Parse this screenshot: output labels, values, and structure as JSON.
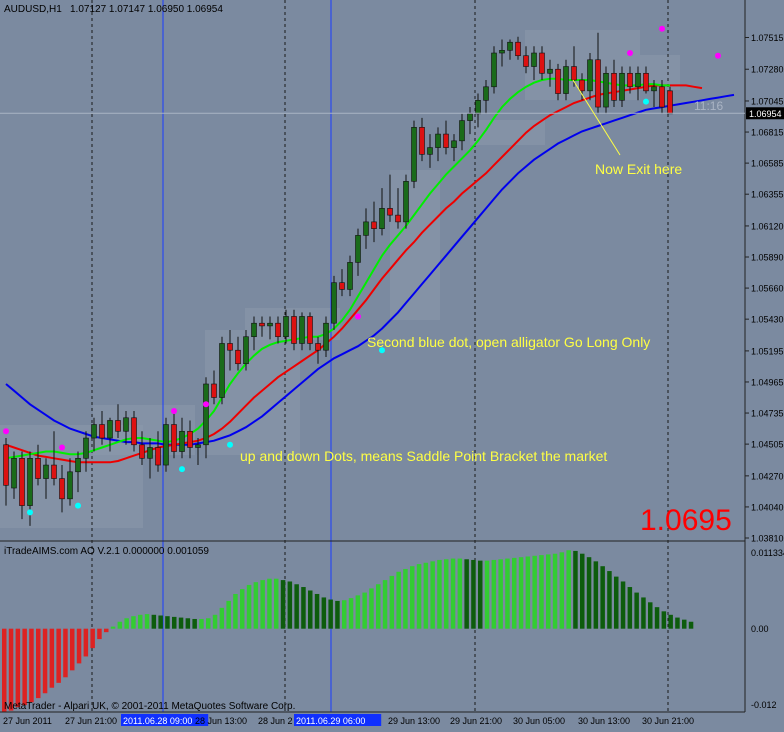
{
  "header": {
    "symbol": "AUDUSD,H1",
    "ohlc": "1.07127 1.07147 1.06950 1.06954"
  },
  "colors": {
    "background": "#7b8aa0",
    "bull_candle": "#1a6b1a",
    "bear_candle": "#dd1111",
    "green_line": "#00ee00",
    "red_line": "#ee0000",
    "blue_line": "#0000ee",
    "magenta_dot": "#ff00ff",
    "cyan_dot": "#00ffff",
    "annotation_text": "#ffff44",
    "big_price": "#ff0000"
  },
  "price_axis": {
    "ticks": [
      "1.07515",
      "1.07280",
      "1.07045",
      "1.06815",
      "1.06585",
      "1.06355",
      "1.06120",
      "1.05890",
      "1.05660",
      "1.05430",
      "1.05195",
      "1.04965",
      "1.04735",
      "1.04505",
      "1.04270",
      "1.04040",
      "1.03810"
    ],
    "current_price_label": "1.06954"
  },
  "time_label": "11:16",
  "big_price": "1.0695",
  "annotations": {
    "exit": "Now Exit here",
    "long": "Second blue dot, open alligator Go Long Only",
    "saddle": "up and down Dots, means Saddle Point Bracket the market"
  },
  "indicator": {
    "title": "iTradeAIMS.com AO V.2.1 0.000000 0.001059",
    "axis_ticks": [
      "0.011334",
      "0.00",
      "-0.012"
    ]
  },
  "copyright": "MetaTrader - Alpari UK, © 2001-2011 MetaQuotes Software Corp.",
  "time_axis": {
    "labels": [
      "27 Jun 2011",
      "27 Jun 21:00",
      "2011.06.28 09:00",
      "28 Jun 13:00",
      "28 Jun 2",
      "2011.06.29 06:00",
      "29 Jun 13:00",
      "29 Jun 21:00",
      "30 Jun 05:00",
      "30 Jun 13:00",
      "30 Jun 21:00"
    ],
    "highlighted": [
      "2011.06.28 09:00",
      "2011.06.29 06:00"
    ]
  },
  "chart_data": {
    "type": "candlestick",
    "symbol": "AUDUSD,H1",
    "ylim": [
      1.0381,
      1.076
    ],
    "candles": [
      {
        "o": 1.045,
        "h": 1.0455,
        "l": 1.0405,
        "c": 1.042
      },
      {
        "o": 1.0418,
        "h": 1.0445,
        "l": 1.041,
        "c": 1.044
      },
      {
        "o": 1.044,
        "h": 1.0445,
        "l": 1.0395,
        "c": 1.0405
      },
      {
        "o": 1.0405,
        "h": 1.0445,
        "l": 1.039,
        "c": 1.044
      },
      {
        "o": 1.044,
        "h": 1.045,
        "l": 1.042,
        "c": 1.0425
      },
      {
        "o": 1.0425,
        "h": 1.044,
        "l": 1.041,
        "c": 1.0435
      },
      {
        "o": 1.0435,
        "h": 1.046,
        "l": 1.042,
        "c": 1.0425
      },
      {
        "o": 1.0425,
        "h": 1.0435,
        "l": 1.04,
        "c": 1.041
      },
      {
        "o": 1.041,
        "h": 1.044,
        "l": 1.0405,
        "c": 1.043
      },
      {
        "o": 1.043,
        "h": 1.0445,
        "l": 1.0415,
        "c": 1.044
      },
      {
        "o": 1.044,
        "h": 1.046,
        "l": 1.043,
        "c": 1.0455
      },
      {
        "o": 1.0455,
        "h": 1.047,
        "l": 1.0445,
        "c": 1.0465
      },
      {
        "o": 1.0465,
        "h": 1.0475,
        "l": 1.045,
        "c": 1.0455
      },
      {
        "o": 1.0455,
        "h": 1.047,
        "l": 1.0445,
        "c": 1.0468
      },
      {
        "o": 1.0468,
        "h": 1.048,
        "l": 1.0455,
        "c": 1.046
      },
      {
        "o": 1.046,
        "h": 1.0475,
        "l": 1.045,
        "c": 1.047
      },
      {
        "o": 1.047,
        "h": 1.0475,
        "l": 1.0445,
        "c": 1.045
      },
      {
        "o": 1.045,
        "h": 1.046,
        "l": 1.0435,
        "c": 1.044
      },
      {
        "o": 1.044,
        "h": 1.0455,
        "l": 1.0425,
        "c": 1.0448
      },
      {
        "o": 1.0448,
        "h": 1.046,
        "l": 1.043,
        "c": 1.0435
      },
      {
        "o": 1.0435,
        "h": 1.047,
        "l": 1.043,
        "c": 1.0465
      },
      {
        "o": 1.0465,
        "h": 1.0475,
        "l": 1.044,
        "c": 1.0445
      },
      {
        "o": 1.0445,
        "h": 1.047,
        "l": 1.044,
        "c": 1.046
      },
      {
        "o": 1.046,
        "h": 1.0468,
        "l": 1.044,
        "c": 1.0448
      },
      {
        "o": 1.0448,
        "h": 1.0455,
        "l": 1.0435,
        "c": 1.045
      },
      {
        "o": 1.045,
        "h": 1.05,
        "l": 1.044,
        "c": 1.0495
      },
      {
        "o": 1.0495,
        "h": 1.0505,
        "l": 1.048,
        "c": 1.0485
      },
      {
        "o": 1.0485,
        "h": 1.053,
        "l": 1.048,
        "c": 1.0525
      },
      {
        "o": 1.0525,
        "h": 1.0535,
        "l": 1.0505,
        "c": 1.052
      },
      {
        "o": 1.052,
        "h": 1.053,
        "l": 1.0505,
        "c": 1.051
      },
      {
        "o": 1.051,
        "h": 1.0535,
        "l": 1.0505,
        "c": 1.053
      },
      {
        "o": 1.053,
        "h": 1.0545,
        "l": 1.052,
        "c": 1.054
      },
      {
        "o": 1.054,
        "h": 1.0545,
        "l": 1.053,
        "c": 1.0538
      },
      {
        "o": 1.0538,
        "h": 1.0545,
        "l": 1.0528,
        "c": 1.054
      },
      {
        "o": 1.054,
        "h": 1.0545,
        "l": 1.0525,
        "c": 1.053
      },
      {
        "o": 1.053,
        "h": 1.055,
        "l": 1.0525,
        "c": 1.0545
      },
      {
        "o": 1.0545,
        "h": 1.055,
        "l": 1.052,
        "c": 1.0525
      },
      {
        "o": 1.0525,
        "h": 1.0548,
        "l": 1.052,
        "c": 1.0545
      },
      {
        "o": 1.0545,
        "h": 1.0548,
        "l": 1.052,
        "c": 1.0525
      },
      {
        "o": 1.0525,
        "h": 1.053,
        "l": 1.051,
        "c": 1.052
      },
      {
        "o": 1.052,
        "h": 1.0545,
        "l": 1.0515,
        "c": 1.054
      },
      {
        "o": 1.054,
        "h": 1.0575,
        "l": 1.0535,
        "c": 1.057
      },
      {
        "o": 1.057,
        "h": 1.058,
        "l": 1.056,
        "c": 1.0565
      },
      {
        "o": 1.0565,
        "h": 1.059,
        "l": 1.056,
        "c": 1.0585
      },
      {
        "o": 1.0585,
        "h": 1.061,
        "l": 1.0575,
        "c": 1.0605
      },
      {
        "o": 1.0605,
        "h": 1.0625,
        "l": 1.0595,
        "c": 1.0615
      },
      {
        "o": 1.0615,
        "h": 1.063,
        "l": 1.06,
        "c": 1.061
      },
      {
        "o": 1.061,
        "h": 1.064,
        "l": 1.0605,
        "c": 1.0625
      },
      {
        "o": 1.0625,
        "h": 1.065,
        "l": 1.0615,
        "c": 1.062
      },
      {
        "o": 1.062,
        "h": 1.064,
        "l": 1.061,
        "c": 1.0615
      },
      {
        "o": 1.0615,
        "h": 1.065,
        "l": 1.061,
        "c": 1.0645
      },
      {
        "o": 1.0645,
        "h": 1.069,
        "l": 1.064,
        "c": 1.0685
      },
      {
        "o": 1.0685,
        "h": 1.0692,
        "l": 1.066,
        "c": 1.0665
      },
      {
        "o": 1.0665,
        "h": 1.068,
        "l": 1.0655,
        "c": 1.067
      },
      {
        "o": 1.067,
        "h": 1.0685,
        "l": 1.066,
        "c": 1.068
      },
      {
        "o": 1.068,
        "h": 1.069,
        "l": 1.0665,
        "c": 1.067
      },
      {
        "o": 1.067,
        "h": 1.068,
        "l": 1.066,
        "c": 1.0675
      },
      {
        "o": 1.0675,
        "h": 1.0695,
        "l": 1.0668,
        "c": 1.069
      },
      {
        "o": 1.069,
        "h": 1.07,
        "l": 1.068,
        "c": 1.0695
      },
      {
        "o": 1.0695,
        "h": 1.071,
        "l": 1.0685,
        "c": 1.0705
      },
      {
        "o": 1.0705,
        "h": 1.072,
        "l": 1.0695,
        "c": 1.0715
      },
      {
        "o": 1.0715,
        "h": 1.0745,
        "l": 1.071,
        "c": 1.074
      },
      {
        "o": 1.074,
        "h": 1.075,
        "l": 1.073,
        "c": 1.0742
      },
      {
        "o": 1.0742,
        "h": 1.075,
        "l": 1.0735,
        "c": 1.0748
      },
      {
        "o": 1.0748,
        "h": 1.0752,
        "l": 1.0735,
        "c": 1.0738
      },
      {
        "o": 1.0738,
        "h": 1.0745,
        "l": 1.0725,
        "c": 1.073
      },
      {
        "o": 1.073,
        "h": 1.0745,
        "l": 1.072,
        "c": 1.074
      },
      {
        "o": 1.074,
        "h": 1.0745,
        "l": 1.072,
        "c": 1.0725
      },
      {
        "o": 1.0725,
        "h": 1.0735,
        "l": 1.0715,
        "c": 1.0728
      },
      {
        "o": 1.0728,
        "h": 1.0732,
        "l": 1.0705,
        "c": 1.071
      },
      {
        "o": 1.071,
        "h": 1.0735,
        "l": 1.0705,
        "c": 1.073
      },
      {
        "o": 1.073,
        "h": 1.0745,
        "l": 1.0715,
        "c": 1.072
      },
      {
        "o": 1.072,
        "h": 1.0725,
        "l": 1.0705,
        "c": 1.0712
      },
      {
        "o": 1.0712,
        "h": 1.074,
        "l": 1.0705,
        "c": 1.0735
      },
      {
        "o": 1.0735,
        "h": 1.0755,
        "l": 1.0695,
        "c": 1.07
      },
      {
        "o": 1.07,
        "h": 1.073,
        "l": 1.0695,
        "c": 1.0725
      },
      {
        "o": 1.0725,
        "h": 1.0735,
        "l": 1.07,
        "c": 1.0705
      },
      {
        "o": 1.0705,
        "h": 1.073,
        "l": 1.07,
        "c": 1.0725
      },
      {
        "o": 1.0725,
        "h": 1.073,
        "l": 1.071,
        "c": 1.0715
      },
      {
        "o": 1.0715,
        "h": 1.073,
        "l": 1.0705,
        "c": 1.0725
      },
      {
        "o": 1.0725,
        "h": 1.073,
        "l": 1.071,
        "c": 1.0712
      },
      {
        "o": 1.0712,
        "h": 1.072,
        "l": 1.07,
        "c": 1.0715
      },
      {
        "o": 1.0715,
        "h": 1.072,
        "l": 1.0695,
        "c": 1.07
      },
      {
        "o": 1.0712,
        "h": 1.0715,
        "l": 1.0695,
        "c": 1.0695
      }
    ],
    "green_line": [
      1.044,
      1.0441,
      1.0442,
      1.0443,
      1.0444,
      1.0445,
      1.0445,
      1.0444,
      1.0443,
      1.0443,
      1.0444,
      1.0446,
      1.0448,
      1.045,
      1.0452,
      1.0454,
      1.0455,
      1.0455,
      1.0454,
      1.0453,
      1.0452,
      1.0453,
      1.0455,
      1.0458,
      1.0462,
      1.0468,
      1.0475,
      1.0485,
      1.0495,
      1.0503,
      1.051,
      1.0516,
      1.0521,
      1.0524,
      1.0526,
      1.0527,
      1.0528,
      1.0529,
      1.053,
      1.053,
      1.0532,
      1.0536,
      1.0542,
      1.055,
      1.056,
      1.057,
      1.058,
      1.059,
      1.0598,
      1.0605,
      1.0612,
      1.062,
      1.0628,
      1.0636,
      1.0643,
      1.065,
      1.0656,
      1.0662,
      1.0668,
      1.0675,
      1.0683,
      1.0692,
      1.07,
      1.0706,
      1.0711,
      1.0715,
      1.0718,
      1.072,
      1.0721,
      1.0721,
      1.072,
      1.072,
      1.072,
      1.072,
      1.0719,
      1.0718,
      1.0717,
      1.0716,
      1.0716,
      1.0716,
      1.0717,
      1.0717,
      1.0716,
      1.0716
    ],
    "red_line": [
      1.045,
      1.0448,
      1.0446,
      1.0444,
      1.0442,
      1.0441,
      1.044,
      1.0439,
      1.0438,
      1.0437,
      1.0437,
      1.0437,
      1.0437,
      1.0437,
      1.0438,
      1.044,
      1.0442,
      1.0444,
      1.0446,
      1.0448,
      1.0449,
      1.045,
      1.0451,
      1.0452,
      1.0453,
      1.0455,
      1.0458,
      1.0462,
      1.0467,
      1.0473,
      1.0479,
      1.0485,
      1.049,
      1.0495,
      1.05,
      1.0504,
      1.0508,
      1.0512,
      1.0516,
      1.052,
      1.0525,
      1.053,
      1.0536,
      1.0543,
      1.055,
      1.0557,
      1.0565,
      1.0573,
      1.058,
      1.0587,
      1.0594,
      1.06,
      1.0607,
      1.0613,
      1.0619,
      1.0625,
      1.063,
      1.0636,
      1.0641,
      1.0646,
      1.0651,
      1.0657,
      1.0663,
      1.0669,
      1.0675,
      1.0681,
      1.0686,
      1.069,
      1.0694,
      1.0697,
      1.07,
      1.0703,
      1.0705,
      1.0707,
      1.0709,
      1.071,
      1.0711,
      1.0712,
      1.0713,
      1.0714,
      1.0715,
      1.0716,
      1.0716,
      1.0716,
      1.0716,
      1.0716,
      1.0715,
      1.0714
    ],
    "blue_line": [
      1.0495,
      1.049,
      1.0485,
      1.048,
      1.0476,
      1.0472,
      1.0468,
      1.0465,
      1.0462,
      1.046,
      1.0458,
      1.0456,
      1.0455,
      1.0454,
      1.0453,
      1.0452,
      1.0452,
      1.0451,
      1.0451,
      1.0451,
      1.045,
      1.045,
      1.045,
      1.045,
      1.0451,
      1.0452,
      1.0453,
      1.0455,
      1.0457,
      1.046,
      1.0463,
      1.0467,
      1.0471,
      1.0476,
      1.0481,
      1.0486,
      1.0491,
      1.0496,
      1.0501,
      1.0506,
      1.051,
      1.0514,
      1.0517,
      1.052,
      1.0523,
      1.0527,
      1.0531,
      1.0536,
      1.0542,
      1.0548,
      1.0555,
      1.0562,
      1.0569,
      1.0576,
      1.0583,
      1.059,
      1.0597,
      1.0604,
      1.0611,
      1.0618,
      1.0625,
      1.0632,
      1.0639,
      1.0645,
      1.0651,
      1.0656,
      1.0661,
      1.0665,
      1.0669,
      1.0673,
      1.0676,
      1.0679,
      1.0682,
      1.0684,
      1.0686,
      1.0688,
      1.069,
      1.0692,
      1.0694,
      1.0696,
      1.0698,
      1.0699,
      1.07,
      1.0701,
      1.0702,
      1.0703,
      1.0704,
      1.0705,
      1.0706,
      1.0707,
      1.0708,
      1.0709
    ],
    "magenta_dots": [
      {
        "i": 0,
        "y": 1.046
      },
      {
        "i": 7,
        "y": 1.0448
      },
      {
        "i": 21,
        "y": 1.0475
      },
      {
        "i": 25,
        "y": 1.048
      },
      {
        "i": 44,
        "y": 1.0545
      },
      {
        "i": 78,
        "y": 1.074
      },
      {
        "i": 82,
        "y": 1.0758
      },
      {
        "i": 89,
        "y": 1.0738
      }
    ],
    "cyan_dots": [
      {
        "i": 3,
        "y": 1.04
      },
      {
        "i": 9,
        "y": 1.0405
      },
      {
        "i": 22,
        "y": 1.0432
      },
      {
        "i": 28,
        "y": 1.045
      },
      {
        "i": 47,
        "y": 1.052
      },
      {
        "i": 80,
        "y": 1.0704
      }
    ],
    "ao_values": [
      -0.012,
      -0.0118,
      -0.0113,
      -0.011,
      -0.0106,
      -0.01,
      -0.0093,
      -0.0085,
      -0.0078,
      -0.007,
      -0.006,
      -0.005,
      -0.004,
      -0.0028,
      -0.0015,
      -0.0005,
      0.0003,
      0.001,
      0.0015,
      0.0018,
      0.002,
      0.0021,
      0.002,
      0.0019,
      0.0018,
      0.0017,
      0.0016,
      0.0015,
      0.0014,
      0.0014,
      0.0015,
      0.002,
      0.003,
      0.004,
      0.005,
      0.0057,
      0.0063,
      0.0067,
      0.007,
      0.0072,
      0.0072,
      0.007,
      0.0068,
      0.0064,
      0.006,
      0.0055,
      0.005,
      0.0045,
      0.0042,
      0.004,
      0.0041,
      0.0044,
      0.0048,
      0.0052,
      0.0058,
      0.0064,
      0.007,
      0.0076,
      0.0082,
      0.0086,
      0.009,
      0.0093,
      0.0095,
      0.0097,
      0.0099,
      0.01,
      0.0101,
      0.0101,
      0.01,
      0.0099,
      0.0098,
      0.0098,
      0.0099,
      0.01,
      0.0101,
      0.0102,
      0.0103,
      0.0104,
      0.0105,
      0.0106,
      0.0107,
      0.0108,
      0.011,
      0.0113,
      0.0112,
      0.0108,
      0.0103,
      0.0097,
      0.009,
      0.0083,
      0.0075,
      0.0068,
      0.006,
      0.0052,
      0.0045,
      0.0038,
      0.0031,
      0.0025,
      0.002,
      0.0016,
      0.0013,
      0.001
    ],
    "ao_ylim": [
      -0.012,
      0.011334
    ]
  }
}
